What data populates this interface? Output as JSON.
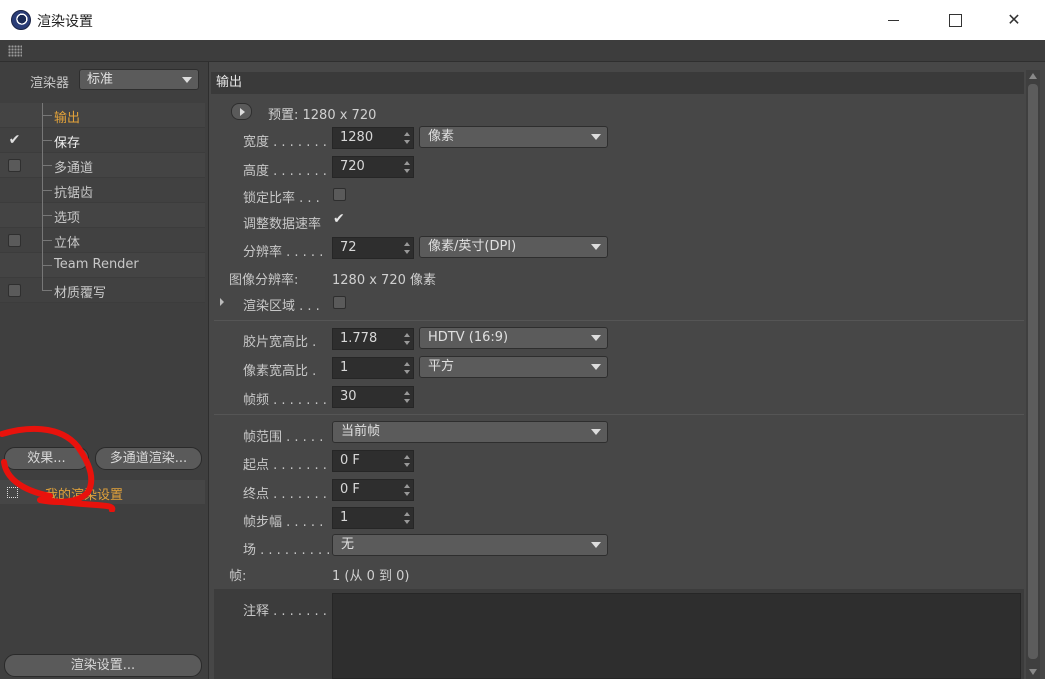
{
  "window": {
    "title": "渲染设置"
  },
  "left": {
    "renderer_label": "渲染器",
    "renderer_value": "标准",
    "tree": [
      {
        "label": "输出",
        "checked": null,
        "active": true
      },
      {
        "label": "保存",
        "checked": true,
        "active": false
      },
      {
        "label": "多通道",
        "checked": false,
        "active": false
      },
      {
        "label": "抗锯齿",
        "checked": null,
        "active": false
      },
      {
        "label": "选项",
        "checked": null,
        "active": false
      },
      {
        "label": "立体",
        "checked": false,
        "active": false
      },
      {
        "label": "Team Render",
        "checked": null,
        "active": false
      },
      {
        "label": "材质覆写",
        "checked": false,
        "active": false
      }
    ],
    "effects_button": "效果...",
    "multipass_button": "多通道渲染...",
    "preset_label": "我的渲染设置",
    "render_settings_button": "渲染设置...",
    "annotation_color": "#e8120c"
  },
  "main": {
    "header": "输出",
    "preset": "预置: 1280 x 720",
    "width_label": "宽度 . . . . . . .",
    "width_value": "1280",
    "width_unit": "像素",
    "height_label": "高度 . . . . . . .",
    "height_value": "720",
    "lock_ratio_label": "锁定比率 . . .",
    "adjust_rate_label": "调整数据速率",
    "resolution_label": "分辨率 . . . . .",
    "resolution_value": "72",
    "resolution_unit": "像素/英寸(DPI)",
    "image_resolution_label": "图像分辨率:",
    "image_resolution_value": "1280 x 720 像素",
    "render_region_label": "渲染区域 . . .",
    "film_aspect_label": "胶片宽高比 .",
    "film_aspect_value": "1.778",
    "film_aspect_preset": "HDTV (16:9)",
    "pixel_aspect_label": "像素宽高比 .",
    "pixel_aspect_value": "1",
    "pixel_aspect_preset": "平方",
    "fps_label": "帧频 . . . . . . .",
    "fps_value": "30",
    "frame_range_label": "帧范围 . . . . .",
    "frame_range_value": "当前帧",
    "start_label": "起点 . . . . . . .",
    "start_value": "0 F",
    "end_label": "终点 . . . . . . .",
    "end_value": "0 F",
    "frame_step_label": "帧步幅 . . . . .",
    "frame_step_value": "1",
    "field_label": "场 . . . . . . . . .",
    "field_value": "无",
    "frames_label": "帧:",
    "frames_value": "1 (从 0 到 0)",
    "notes_label": "注释 . . . . . . ."
  }
}
